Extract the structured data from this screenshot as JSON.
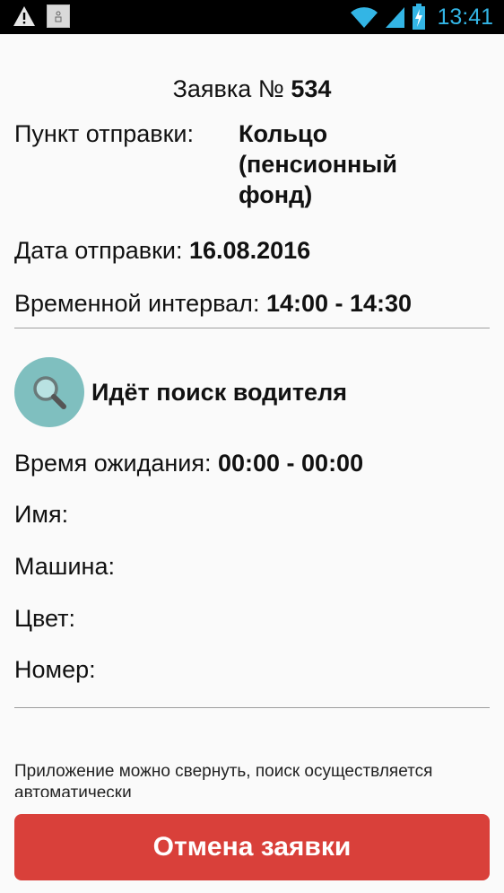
{
  "status_bar": {
    "time": "13:41",
    "icons": [
      "warning-icon",
      "notification-image-icon",
      "wifi-icon",
      "cell-signal-icon",
      "battery-charging-icon"
    ]
  },
  "order": {
    "title_prefix": "Заявка №",
    "number": "534",
    "origin_label": "Пункт отправки:",
    "origin_value": "Кольцо (пенсионный фонд)",
    "date_label": "Дата отправки:",
    "date_value": "16.08.2016",
    "interval_label": "Временной интервал:",
    "interval_value": "14:00 - 14:30"
  },
  "driver": {
    "status": "Идёт поиск водителя",
    "wait_label": "Время ожидания:",
    "wait_value": "00:00 - 00:00",
    "name_label": "Имя:",
    "car_label": "Машина:",
    "color_label": "Цвет:",
    "plate_label": "Номер:"
  },
  "hint": "Приложение можно свернуть, поиск осуществляется автоматически",
  "cancel_label": "Отмена заявки",
  "colors": {
    "accent": "#33b5e5",
    "search_circle": "#7fbfbf",
    "cancel_button": "#d9403a"
  }
}
